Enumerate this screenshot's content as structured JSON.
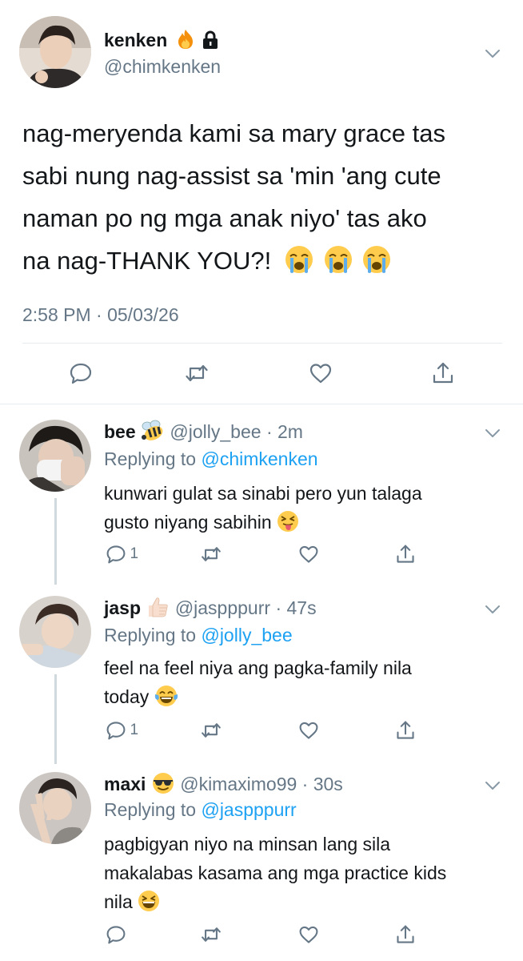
{
  "main_tweet": {
    "name": "kenken",
    "name_emojis": [
      "fire-emoji",
      "lock-icon"
    ],
    "handle": "@chimkenken",
    "lines": [
      "nag-meryenda kami sa mary grace tas",
      "sabi nung nag-assist sa 'min 'ang cute",
      "naman po ng mga anak niyo' tas ako",
      "na nag-THANK YOU?!"
    ],
    "trailing_emojis": [
      "loudly-crying-emoji",
      "loudly-crying-emoji",
      "loudly-crying-emoji"
    ],
    "timestamp": "2:58 PM · 05/03/26"
  },
  "replies": [
    {
      "name": "bee",
      "name_emoji": "bee-emoji",
      "handle": "@jolly_bee",
      "time": "· 2m",
      "replying_prefix": "Replying to",
      "replying_to": "@chimkenken",
      "lines": [
        "kunwari gulat sa sinabi pero yun talaga",
        "gusto niyang sabihin"
      ],
      "trailing_emoji": "tongue-squint-emoji",
      "reply_count": "1"
    },
    {
      "name": "jasp",
      "name_emoji": "thumbs-up-emoji",
      "handle": "@jaspppurr",
      "time": "· 47s",
      "replying_prefix": "Replying to",
      "replying_to": "@jolly_bee",
      "lines": [
        "feel na feel niya ang pagka-family nila",
        "today"
      ],
      "trailing_emoji": "tears-of-joy-emoji",
      "reply_count": "1"
    },
    {
      "name": "maxi",
      "name_emoji": "sunglasses-emoji",
      "handle": "@kimaximo99",
      "time": "· 30s",
      "replying_prefix": "Replying to",
      "replying_to": "@jaspppurr",
      "lines": [
        "pagbigyan niyo na minsan lang sila",
        "makalabas kasama ang mga practice kids",
        "nila"
      ],
      "trailing_emoji": "grinning-squint-emoji",
      "reply_count": ""
    }
  ],
  "colors": {
    "text": "#14171a",
    "secondary": "#657786",
    "link": "#1da1f2",
    "divider": "#e6ecf0",
    "thread_line": "#cfd9de"
  }
}
